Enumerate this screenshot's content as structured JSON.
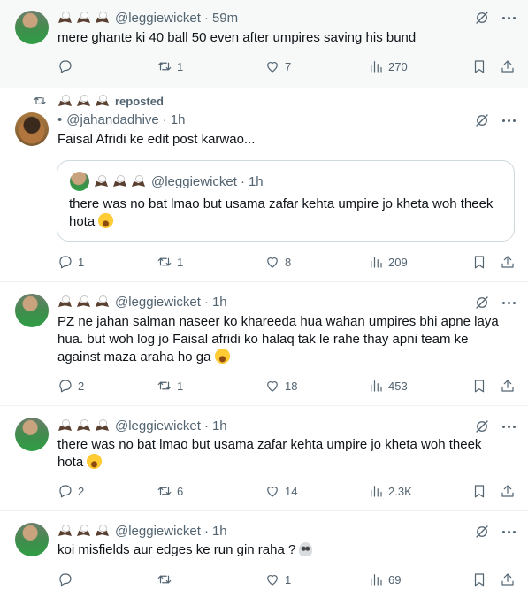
{
  "posts": [
    {
      "handle": "@leggiewicket",
      "time": "59m",
      "text": "mere ghante ki 40 ball 50 even after umpires saving his bund",
      "emoji": "",
      "replies": "",
      "reposts": "1",
      "likes": "7",
      "views": "270"
    },
    {
      "repost_label": "reposted",
      "handle": "@jahandadhive",
      "name_prefix": "•",
      "time": "1h",
      "text": "Faisal Afridi ke edit post karwao...",
      "quote": {
        "handle": "@leggiewicket",
        "time": "1h",
        "text": "there was no bat lmao but usama zafar kehta umpire jo kheta woh theek hota"
      },
      "replies": "1",
      "reposts": "1",
      "likes": "8",
      "views": "209"
    },
    {
      "handle": "@leggiewicket",
      "time": "1h",
      "text": "PZ ne jahan salman naseer ko khareeda hua wahan umpires bhi apne laya hua. but woh log jo Faisal afridi ko halaq tak le rahe thay apni team ke against maza araha ho ga",
      "replies": "2",
      "reposts": "1",
      "likes": "18",
      "views": "453"
    },
    {
      "handle": "@leggiewicket",
      "time": "1h",
      "text": "there was no bat lmao but usama zafar kehta umpire jo kheta woh theek hota",
      "replies": "2",
      "reposts": "6",
      "likes": "14",
      "views": "2.3K"
    },
    {
      "handle": "@leggiewicket",
      "time": "1h",
      "text": "koi misfields aur edges ke run gin raha ?",
      "replies": "",
      "reposts": "",
      "likes": "1",
      "views": "69"
    }
  ],
  "icons": [
    "reply-icon",
    "retweet-icon",
    "like-icon",
    "views-icon",
    "bookmark-icon",
    "share-icon",
    "grok-icon",
    "more-icon"
  ],
  "colors": {
    "text": "#0f1419",
    "muted": "#536471",
    "border": "#eff3f4",
    "highlight_bg": "#f7f9f9"
  }
}
